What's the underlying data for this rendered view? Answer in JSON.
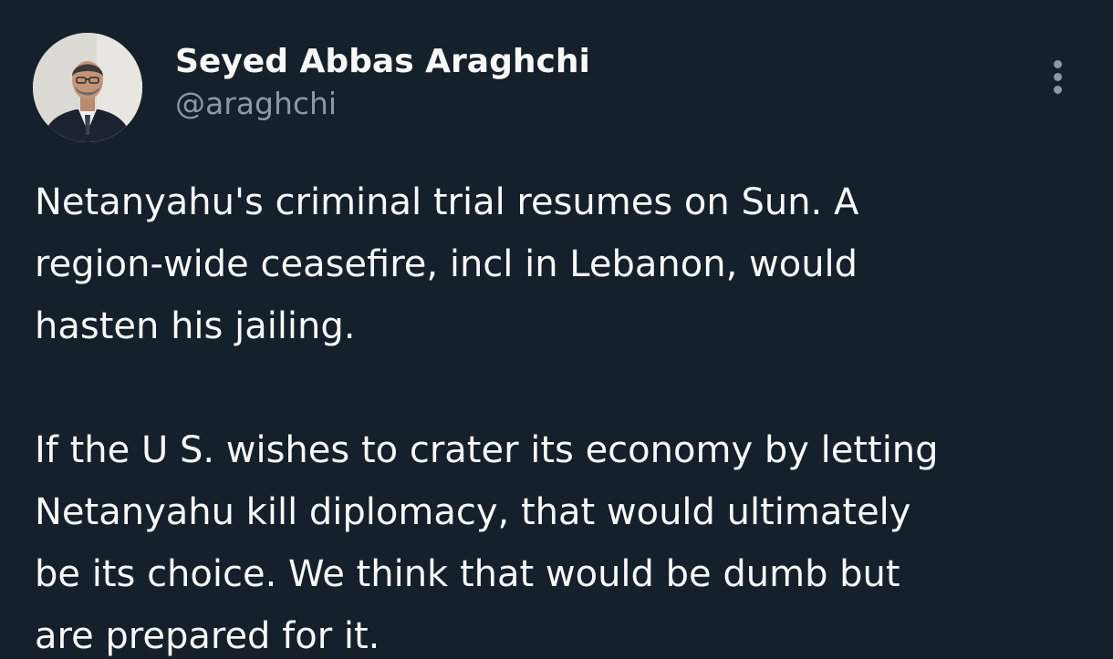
{
  "author": {
    "display_name": "Seyed Abbas Araghchi",
    "handle": "@araghchi"
  },
  "tweet": {
    "paragraph_1": [
      "Netanyahu's criminal trial resumes on Sun. A",
      "region-wide ceasefire, incl in Lebanon, would",
      "hasten his jailing."
    ],
    "paragraph_2": [
      "If the U S. wishes to crater its economy by letting",
      "Netanyahu kill diplomacy, that would ultimately",
      "be its choice. We think that would be dumb but",
      "are prepared for it."
    ]
  },
  "icons": {
    "more": "more-vertical-icon",
    "avatar": "profile-photo"
  },
  "colors": {
    "background": "#15202b",
    "primary_text": "#f7f9f9",
    "secondary_text": "#8b98a5"
  }
}
